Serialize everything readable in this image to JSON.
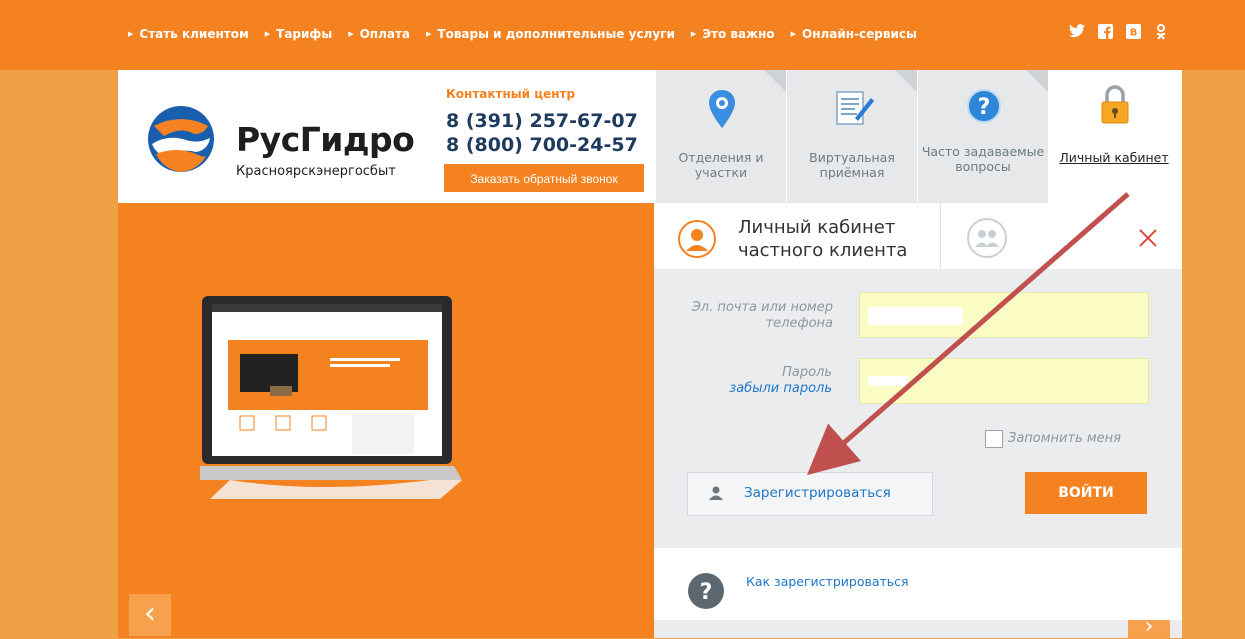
{
  "topnav": {
    "items": [
      "Стать клиентом",
      "Тарифы",
      "Оплата",
      "Товары и дополнительные услуги",
      "Это важно",
      "Онлайн-сервисы"
    ],
    "social": [
      "twitter-icon",
      "facebook-icon",
      "vk-icon",
      "odnoklassniki-icon"
    ]
  },
  "brand": {
    "name": "РусГидро",
    "subtitle": "Красноярскэнергосбыт"
  },
  "contact": {
    "title": "Контактный центр",
    "phone1": "8 (391) 257-67-07",
    "phone2": "8 (800) 700-24-57",
    "callback": "Заказать обратный звонок"
  },
  "tiles": [
    {
      "label": "Отделения и участки",
      "icon": "map-pin-icon"
    },
    {
      "label": "Виртуальная приёмная",
      "icon": "document-pen-icon"
    },
    {
      "label": "Часто задаваемые вопросы",
      "icon": "question-icon"
    },
    {
      "label": "Личный кабинет",
      "icon": "lock-icon"
    }
  ],
  "login": {
    "title": "Личный кабинет частного клиента",
    "email_label": "Эл. почта или номер телефона",
    "password_label": "Пароль",
    "forgot": "забыли пароль",
    "remember": "Запомнить меня",
    "register": "Зарегистрироваться",
    "enter": "ВОЙТИ",
    "how_register": "Как зарегистрироваться"
  },
  "colors": {
    "brand_orange": "#f58220",
    "link_blue": "#1f76c7",
    "annotation_arrow": "#c0504d"
  }
}
